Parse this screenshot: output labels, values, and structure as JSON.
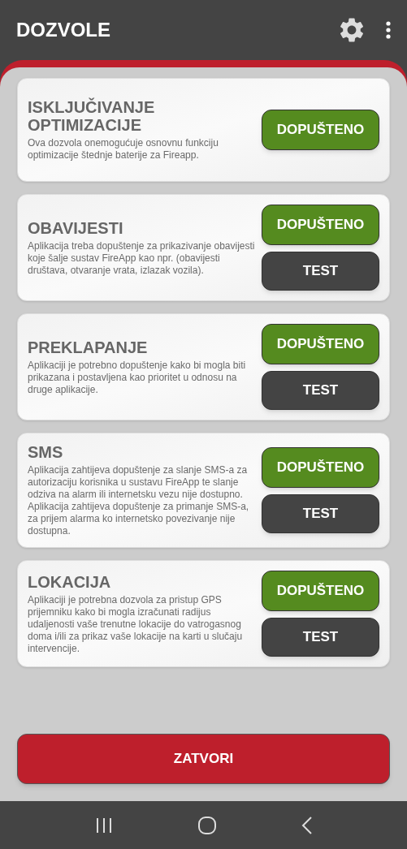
{
  "app_bar": {
    "title": "DOZVOLE"
  },
  "permissions": [
    {
      "title": "ISKLJUČIVANJE OPTIMIZACIJE",
      "description": "Ova dozvola onemogućuje osnovnu funkciju optimizacije štednje baterije za Fireapp.",
      "buttons": [
        {
          "kind": "allowed",
          "label": "DOPUŠTENO"
        }
      ]
    },
    {
      "title": "OBAVIJESTI",
      "description": "Aplikacija treba dopuštenje za prikazivanje obavijesti koje šalje sustav FireApp kao npr. (obavijesti društava, otvaranje vrata, izlazak vozila).",
      "buttons": [
        {
          "kind": "allowed",
          "label": "DOPUŠTENO"
        },
        {
          "kind": "test",
          "label": "TEST"
        }
      ]
    },
    {
      "title": "PREKLAPANJE",
      "description": "Aplikaciji je potrebno dopuštenje kako bi mogla biti prikazana i postavljena kao prioritet u odnosu na druge aplikacije.",
      "buttons": [
        {
          "kind": "allowed",
          "label": "DOPUŠTENO"
        },
        {
          "kind": "test",
          "label": "TEST"
        }
      ]
    },
    {
      "title": "SMS",
      "description": "Aplikacija zahtijeva dopuštenje za slanje SMS-a za autorizaciju korisnika u sustavu FireApp te slanje odziva na alarm ili internetsku vezu nije dostupno. Aplikacija zahtijeva dopuštenje za primanje SMS-a, za prijem alarma ko internetsko povezivanje nije dostupna.",
      "buttons": [
        {
          "kind": "allowed",
          "label": "DOPUŠTENO"
        },
        {
          "kind": "test",
          "label": "TEST"
        }
      ]
    },
    {
      "title": "LOKACIJA",
      "description": "Aplikaciji je potrebna dozvola za pristup GPS prijemniku kako bi mogla izračunati radijus udaljenosti vaše trenutne lokacije do vatrogasnog doma i/ili za prikaz vaše lokacije na karti u slučaju intervencije.",
      "buttons": [
        {
          "kind": "allowed",
          "label": "DOPUŠTENO"
        },
        {
          "kind": "test",
          "label": "TEST"
        }
      ]
    }
  ],
  "close_button": "ZATVORI"
}
